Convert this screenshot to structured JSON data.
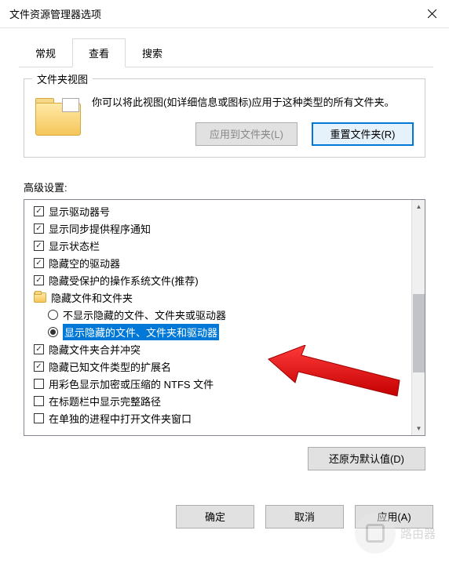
{
  "window": {
    "title": "文件资源管理器选项"
  },
  "tabs": {
    "general": "常规",
    "view": "查看",
    "search": "搜索"
  },
  "folderViews": {
    "title": "文件夹视图",
    "description": "你可以将此视图(如详细信息或图标)应用于这种类型的所有文件夹。",
    "applyBtn": "应用到文件夹(L)",
    "resetBtn": "重置文件夹(R)"
  },
  "advanced": {
    "label": "高级设置:",
    "items": [
      {
        "type": "checkbox",
        "checked": true,
        "label": "显示驱动器号"
      },
      {
        "type": "checkbox",
        "checked": true,
        "label": "显示同步提供程序通知"
      },
      {
        "type": "checkbox",
        "checked": true,
        "label": "显示状态栏"
      },
      {
        "type": "checkbox",
        "checked": true,
        "label": "隐藏空的驱动器"
      },
      {
        "type": "checkbox",
        "checked": true,
        "label": "隐藏受保护的操作系统文件(推荐)"
      },
      {
        "type": "folder",
        "label": "隐藏文件和文件夹"
      },
      {
        "type": "radio",
        "checked": false,
        "indent": 1,
        "label": "不显示隐藏的文件、文件夹或驱动器"
      },
      {
        "type": "radio",
        "checked": true,
        "indent": 1,
        "selected": true,
        "label": "显示隐藏的文件、文件夹和驱动器"
      },
      {
        "type": "checkbox",
        "checked": true,
        "label": "隐藏文件夹合并冲突"
      },
      {
        "type": "checkbox",
        "checked": true,
        "label": "隐藏已知文件类型的扩展名"
      },
      {
        "type": "checkbox",
        "checked": false,
        "label": "用彩色显示加密或压缩的 NTFS 文件"
      },
      {
        "type": "checkbox",
        "checked": false,
        "label": "在标题栏中显示完整路径"
      },
      {
        "type": "checkbox",
        "checked": false,
        "label": "在单独的进程中打开文件夹窗口"
      }
    ]
  },
  "buttons": {
    "restoreDefaults": "还原为默认值(D)",
    "ok": "确定",
    "cancel": "取消",
    "apply": "应用(A)"
  },
  "watermark": {
    "text": "路由器"
  }
}
